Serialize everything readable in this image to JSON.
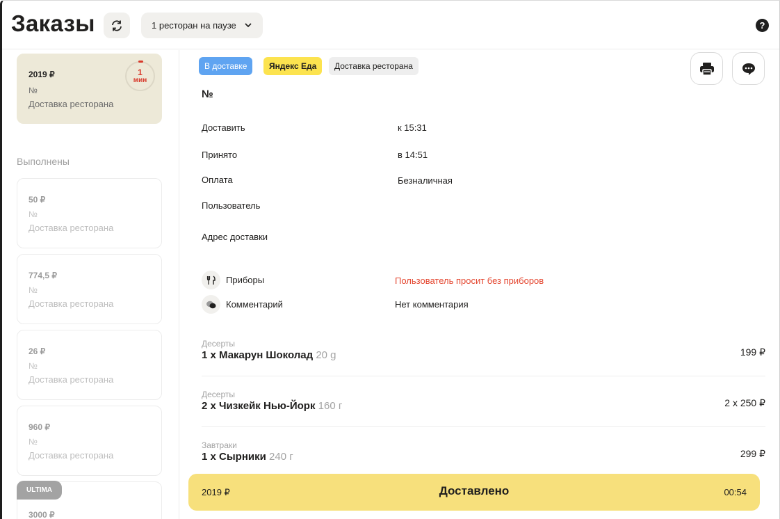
{
  "header": {
    "title": "Заказы",
    "pause_label": "1 ресторан на паузе",
    "icons": {
      "refresh": "refresh-icon",
      "chevron": "chevron-down-icon",
      "help": "help-icon"
    },
    "help_glyph": "?"
  },
  "sidebar": {
    "active_order": {
      "price": "2019 ₽",
      "number": "№",
      "type": "Доставка ресторана",
      "timer_value": "1",
      "timer_unit": "мин"
    },
    "done_section": "Выполнены",
    "done_orders": [
      {
        "price": "50 ₽",
        "number": "№",
        "type": "Доставка ресторана"
      },
      {
        "price": "774,5 ₽",
        "number": "№",
        "type": "Доставка ресторана"
      },
      {
        "price": "26 ₽",
        "number": "№",
        "type": "Доставка ресторана"
      },
      {
        "price": "960 ₽",
        "number": "№",
        "type": "Доставка ресторана"
      },
      {
        "price": "3000 ₽",
        "badge": "ULTIMA"
      }
    ]
  },
  "detail": {
    "badges": [
      "В доставке",
      "Яндекс Еда",
      "Доставка ресторана"
    ],
    "order_number": "№",
    "fields": [
      {
        "label": "Доставить",
        "value": "к 15:31"
      },
      {
        "label": "Принято",
        "value": "в 14:51"
      },
      {
        "label": "Оплата",
        "value": "Безналичная"
      },
      {
        "label": "Пользователь",
        "value": ""
      },
      {
        "label": "Адрес доставки",
        "value": ""
      }
    ],
    "cutlery": {
      "label": "Приборы",
      "value": "Пользователь просит без приборов"
    },
    "comment": {
      "label": "Комментарий",
      "value": "Нет комментария"
    },
    "items": [
      {
        "category": "Десерты",
        "name": "1 x Макарун Шоколад",
        "weight": "20 g",
        "price": "199 ₽"
      },
      {
        "category": "Десерты",
        "name": "2 x Чизкейк Нью-Йорк",
        "weight": "160 г",
        "price": "2 x 250 ₽"
      },
      {
        "category": "Завтраки",
        "name": "1 x Сырники",
        "weight": "240 г",
        "price": "299 ₽"
      }
    ],
    "footer": {
      "total": "2019 ₽",
      "status": "Доставлено",
      "time": "00:54"
    }
  },
  "colors": {
    "delivery_badge": "#5fa4f1",
    "yandex_badge": "#fce34f",
    "active_card": "#ede9d8",
    "footer_bar": "#f7e07c",
    "alert_red": "#e4462f",
    "timer_red": "#d8392b"
  }
}
